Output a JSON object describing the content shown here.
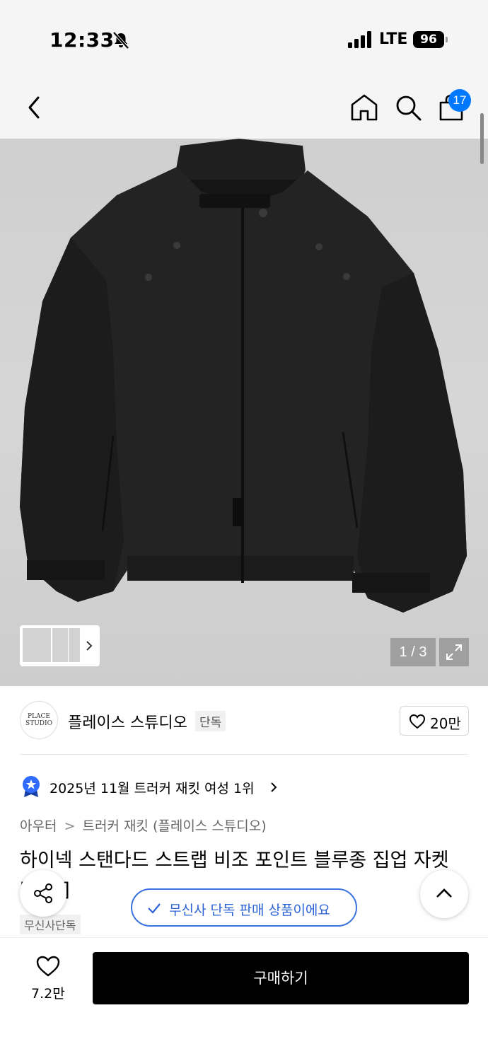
{
  "status_bar": {
    "time": "12:33",
    "network": "LTE",
    "battery": "96"
  },
  "nav": {
    "cart_count": "17",
    "icons": [
      "back-icon",
      "home-icon",
      "search-icon",
      "cart-icon"
    ]
  },
  "gallery": {
    "counter": "1 / 3",
    "thumbnail_count": 3,
    "background": "#d4d4d4"
  },
  "brand": {
    "logo_text": "PLACE STUDIO",
    "name": "플레이스 스튜디오",
    "tag": "단독",
    "likes": "20만"
  },
  "ranking": {
    "text": "2025년 11월 트러커 재킷 여성 1위"
  },
  "breadcrumb": {
    "items": [
      "아우터",
      "트러커 재킷 (플레이스 스튜디오)"
    ],
    "separator": ">"
  },
  "product": {
    "title": "하이넥 스탠다드 스트랩 비조 포인트 블루종 집업 자켓 [블랙]",
    "store_tag": "무신사단독"
  },
  "floating": {
    "exclusive_notice": "무신사 단독 판매 상품이에요"
  },
  "bottom_bar": {
    "wish_count": "7.2만",
    "buy_label": "구매하기"
  },
  "colors": {
    "accent_blue": "#0078ff",
    "pill_blue": "#2b62d6",
    "buy_button": "#000000"
  }
}
